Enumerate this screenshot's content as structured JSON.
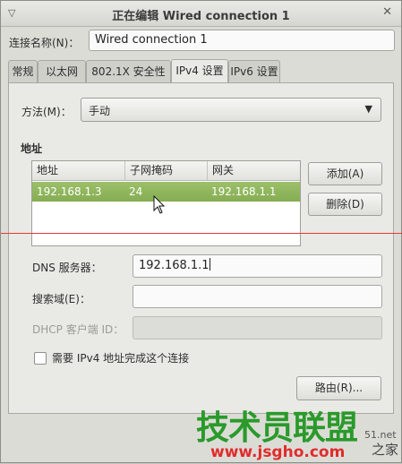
{
  "window": {
    "title": "正在编辑 Wired connection 1"
  },
  "connection": {
    "name_label": "连接名称(N)：",
    "name_value": "Wired connection 1"
  },
  "tabs": [
    {
      "label": "常规"
    },
    {
      "label": "以太网"
    },
    {
      "label": "802.1X 安全性"
    },
    {
      "label": "IPv4 设置"
    },
    {
      "label": "IPv6 设置"
    }
  ],
  "ipv4": {
    "method_label": "方法(M)：",
    "method_value": "手动",
    "address_section": "地址",
    "columns": [
      "地址",
      "子网掩码",
      "网关"
    ],
    "rows": [
      {
        "address": "192.168.1.3",
        "netmask": "24",
        "gateway": "192.168.1.1"
      }
    ],
    "add_button": "添加(A)",
    "delete_button": "删除(D)",
    "dns_label": "DNS 服务器：",
    "dns_value": "192.168.1.1",
    "search_label": "搜索域(E)：",
    "search_value": "",
    "dhcp_label": "DHCP 客户端 ID：",
    "dhcp_value": "",
    "require_label": "需要 IPv4 地址完成这个连接",
    "routes_button": "路由(R)..."
  },
  "watermark": {
    "text": "技术员联盟",
    "url": "www.jsgho.com",
    "side": "之家",
    "partial": "51.net"
  },
  "colors": {
    "selection": "#8fb45c",
    "watermark_green": "#2a9a2a"
  }
}
